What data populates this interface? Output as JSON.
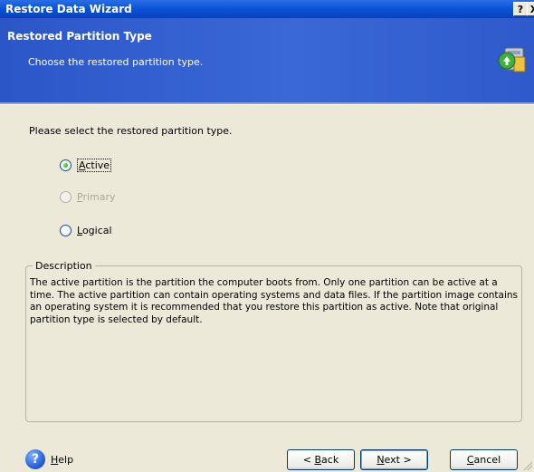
{
  "window": {
    "title": "Restore Data Wizard",
    "help_glyph": "?",
    "close_glyph": "X"
  },
  "header": {
    "title": "Restored Partition Type",
    "subtitle": "Choose the restored partition type.",
    "icon": "wizard-restore-icon"
  },
  "prompt": "Please select the restored partition type.",
  "options": [
    {
      "label_first": "A",
      "label_rest": "ctive",
      "state": "checked",
      "enabled": true
    },
    {
      "label_first": "P",
      "label_rest": "rimary",
      "state": "unchecked",
      "enabled": false
    },
    {
      "label_first": "L",
      "label_rest": "ogical",
      "state": "unchecked",
      "enabled": true
    }
  ],
  "description": {
    "legend": "Description",
    "text": "The active partition is the partition the computer boots from. Only one partition can be active at a time. The active partition can contain operating systems and data files. If the partition image contains an operating system it is recommended that you restore this partition as active. Note that original partition type is selected by default."
  },
  "footer": {
    "help_label_first": "H",
    "help_label_rest": "elp",
    "back_prefix": "< ",
    "back_first": "B",
    "back_rest": "ack",
    "next_first": "N",
    "next_rest": "ext >",
    "cancel_first": "C",
    "cancel_rest": "ancel"
  },
  "colors": {
    "titlebar": "#0a52d6",
    "header": "#3a68d6",
    "face": "#ece9d8"
  }
}
